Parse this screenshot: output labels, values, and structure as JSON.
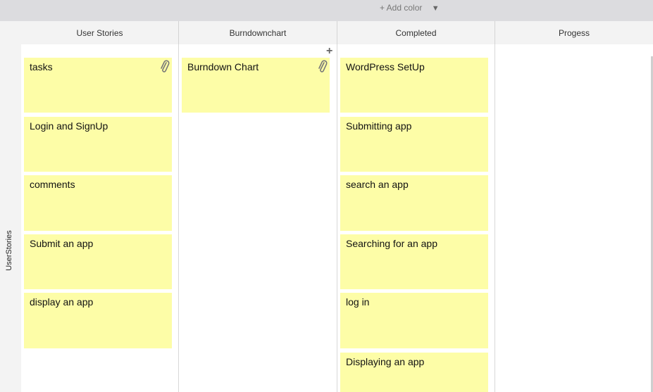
{
  "toolbar": {
    "add_color": "+ Add color",
    "caret": "▼"
  },
  "row": {
    "label": "UserStories"
  },
  "columns": [
    {
      "title": "User Stories"
    },
    {
      "title": "Burndownchart"
    },
    {
      "title": "Completed"
    },
    {
      "title": "Progess"
    }
  ],
  "notes": {
    "user_stories": [
      "tasks",
      "Login and SignUp",
      "comments",
      "Submit an app",
      "display an app"
    ],
    "burndown": [
      "Burndown Chart"
    ],
    "completed": [
      "WordPress SetUp",
      "Submitting app",
      "search an app",
      "Searching for an app",
      "log in",
      "Displaying an app"
    ]
  },
  "icons": {
    "attachment": "paperclip-icon",
    "add": "plus-icon",
    "dropdown": "caret-down-icon"
  },
  "colors": {
    "note": "#fdfda7",
    "header": "#f3f3f3",
    "topbar": "#dcdcdf"
  }
}
